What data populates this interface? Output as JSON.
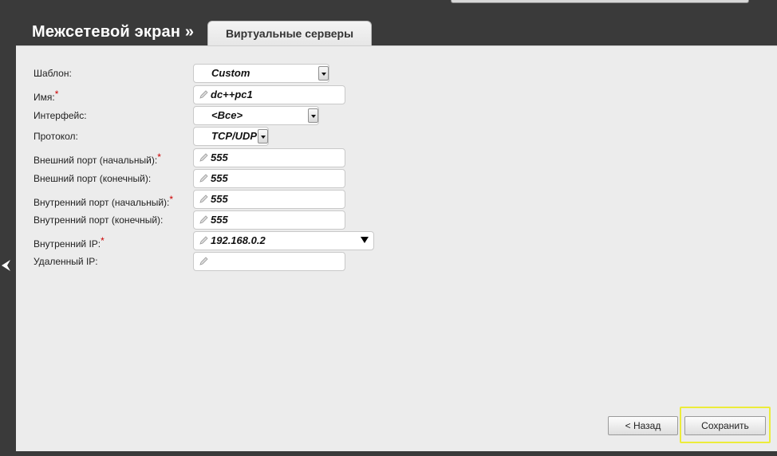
{
  "header": {
    "title": "Межсетевой экран »",
    "tab_label": "Виртуальные серверы"
  },
  "form": {
    "template": {
      "label": "Шаблон:",
      "value": "Custom",
      "required": false
    },
    "name": {
      "label": "Имя:",
      "value": "dc++pc1",
      "required": true
    },
    "interface": {
      "label": "Интерфейс:",
      "value": "<Все>",
      "required": false
    },
    "protocol": {
      "label": "Протокол:",
      "value": "TCP/UDP",
      "required": false
    },
    "ext_port_start": {
      "label": "Внешний порт (начальный):",
      "value": "555",
      "required": true
    },
    "ext_port_end": {
      "label": "Внешний порт (конечный):",
      "value": "555",
      "required": false
    },
    "int_port_start": {
      "label": "Внутренний порт (начальный):",
      "value": "555",
      "required": true
    },
    "int_port_end": {
      "label": "Внутренний порт (конечный):",
      "value": "555",
      "required": false
    },
    "internal_ip": {
      "label": "Внутренний IP:",
      "value": "192.168.0.2",
      "required": true
    },
    "remote_ip": {
      "label": "Удаленный IP:",
      "value": "",
      "required": false
    },
    "required_mark": "*"
  },
  "buttons": {
    "back": "< Назад",
    "save": "Сохранить"
  },
  "colors": {
    "background": "#3a3a3a",
    "panel": "#ececec",
    "required": "#cc0000",
    "highlight": "#ecec3a"
  },
  "icons": {
    "pencil": "pencil-icon",
    "dropdown": "chevron-down-icon",
    "side_nav": "chevron-left-icon"
  }
}
